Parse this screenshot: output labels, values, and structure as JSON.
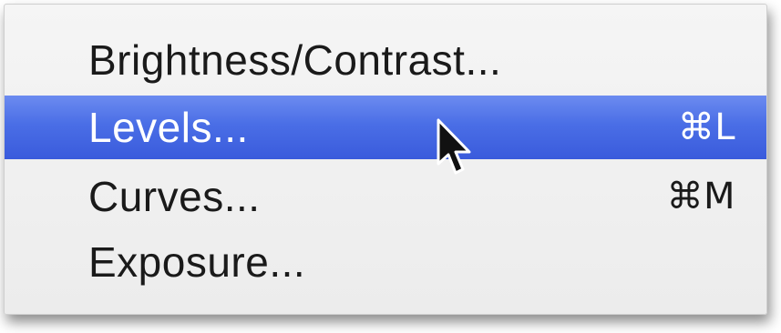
{
  "menu": {
    "items": [
      {
        "label": "Brightness/Contrast...",
        "shortcut": ""
      },
      {
        "label": "Levels...",
        "shortcut": "⌘L",
        "highlighted": true
      },
      {
        "label": "Curves...",
        "shortcut": "⌘M"
      },
      {
        "label": "Exposure...",
        "shortcut": ""
      }
    ]
  },
  "colors": {
    "highlight": "#4a6ee6",
    "text": "#1a1a1a",
    "highlight_text": "#ffffff"
  },
  "cursor": {
    "icon": "arrow-pointer-icon"
  }
}
